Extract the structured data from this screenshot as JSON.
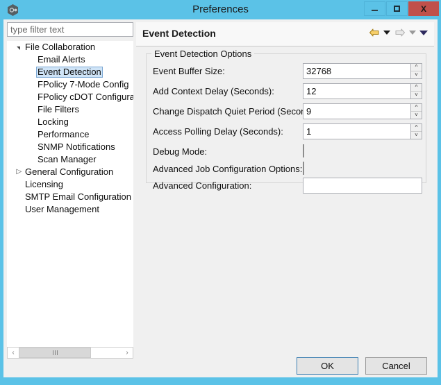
{
  "window": {
    "title": "Preferences",
    "app_icon": "app-hexagon-icon",
    "controls": {
      "minimize": "–",
      "maximize": "□",
      "close": "X"
    },
    "colors": {
      "titlebar": "#5bc2e7",
      "close_button": "#c0504a",
      "selection": "#cfe4f7",
      "accent_border": "#3c7fb1"
    }
  },
  "sidebar": {
    "filter": {
      "placeholder": "type filter text",
      "value": ""
    },
    "items": [
      {
        "label": "File Collaboration",
        "level": 0,
        "twisty": "expanded",
        "selected": false
      },
      {
        "label": "Email Alerts",
        "level": 1,
        "twisty": "none",
        "selected": false
      },
      {
        "label": "Event Detection",
        "level": 1,
        "twisty": "none",
        "selected": true
      },
      {
        "label": "FPolicy 7-Mode Config",
        "level": 1,
        "twisty": "none",
        "selected": false
      },
      {
        "label": "FPolicy cDOT Configura",
        "level": 1,
        "twisty": "none",
        "selected": false
      },
      {
        "label": "File Filters",
        "level": 1,
        "twisty": "none",
        "selected": false
      },
      {
        "label": "Locking",
        "level": 1,
        "twisty": "none",
        "selected": false
      },
      {
        "label": "Performance",
        "level": 1,
        "twisty": "none",
        "selected": false
      },
      {
        "label": "SNMP Notifications",
        "level": 1,
        "twisty": "none",
        "selected": false
      },
      {
        "label": "Scan Manager",
        "level": 1,
        "twisty": "none",
        "selected": false
      },
      {
        "label": "General Configuration",
        "level": 0,
        "twisty": "collapsed",
        "selected": false
      },
      {
        "label": "Licensing",
        "level": 0,
        "twisty": "none",
        "selected": false
      },
      {
        "label": "SMTP Email Configuration",
        "level": 0,
        "twisty": "none",
        "selected": false
      },
      {
        "label": "User Management",
        "level": 0,
        "twisty": "none",
        "selected": false
      }
    ],
    "scrollbar": {
      "left_arrow": "‹",
      "right_arrow": "›"
    }
  },
  "page": {
    "title": "Event Detection",
    "nav": {
      "back": "back-arrow-icon",
      "back_menu": "back-dropdown-icon",
      "forward": "forward-arrow-icon",
      "forward_menu": "forward-dropdown-icon",
      "menu": "view-menu-icon"
    },
    "group": {
      "legend": "Event Detection Options",
      "fields": [
        {
          "label": "Event Buffer Size:",
          "type": "spinner",
          "value": "32768"
        },
        {
          "label": "Add Context Delay (Seconds):",
          "type": "spinner",
          "value": "12"
        },
        {
          "label": "Change Dispatch Quiet Period (Seconds):",
          "type": "spinner",
          "value": "9"
        },
        {
          "label": "Access Polling Delay (Seconds):",
          "type": "spinner",
          "value": "1"
        },
        {
          "label": "Debug Mode:",
          "type": "checkbox",
          "checked": false
        },
        {
          "label": "Advanced Job Configuration Options:",
          "type": "checkbox",
          "checked": false
        },
        {
          "label": "Advanced Configuration:",
          "type": "text",
          "value": ""
        }
      ]
    }
  },
  "footer": {
    "ok_label": "OK",
    "cancel_label": "Cancel"
  }
}
